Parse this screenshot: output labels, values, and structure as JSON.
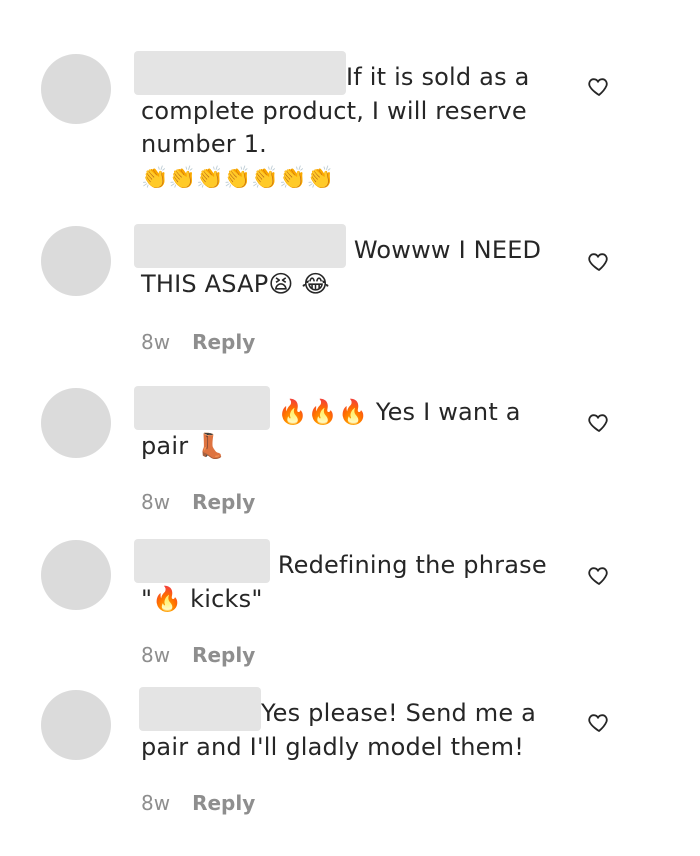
{
  "comments": [
    {
      "text_lead": "If it is sold as a",
      "text_rest": "complete product, I will reserve number 1.",
      "emoji_line": "👏👏👏👏👏👏👏",
      "time": "",
      "reply": ""
    },
    {
      "text_lead": "Wowww I NEED",
      "text_rest": "THIS ASAP😫 😂",
      "emoji_line": "",
      "time": "8w",
      "reply": "Reply"
    },
    {
      "text_lead": "🔥🔥🔥 Yes I want a",
      "text_rest": "pair 👢",
      "emoji_line": "",
      "time": "8w",
      "reply": "Reply"
    },
    {
      "text_lead": "Redefining the phrase",
      "text_rest": "\"🔥 kicks\"",
      "emoji_line": "",
      "time": "8w",
      "reply": "Reply"
    },
    {
      "text_lead": "Yes please! Send me a",
      "text_rest": "pair and I'll gladly model them!",
      "emoji_line": "",
      "time": "8w",
      "reply": "Reply"
    }
  ],
  "icons": {
    "like": "heart-outline-icon"
  },
  "colors": {
    "avatar": "#dbdbdb",
    "redaction": "#e4e4e4",
    "text": "#262626",
    "meta": "#8e8e8e"
  }
}
